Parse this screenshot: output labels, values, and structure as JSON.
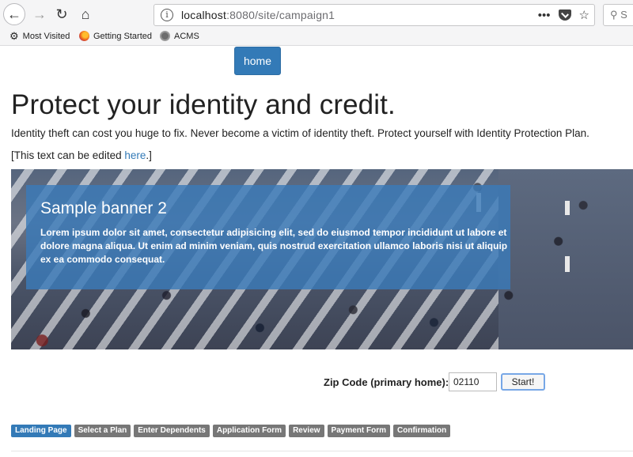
{
  "browser": {
    "url_host": "localhost",
    "url_rest": ":8080/site/campaign1",
    "search_placeholder": "S",
    "bookmarks": [
      {
        "label": "Most Visited",
        "icon": "gear-icon"
      },
      {
        "label": "Getting Started",
        "icon": "firefox-icon"
      },
      {
        "label": "ACMS",
        "icon": "globe-icon"
      }
    ]
  },
  "page": {
    "home_label": "home",
    "headline": "Protect your identity and credit.",
    "intro": "Identity theft can cost you huge to fix. Never become a victim of identity theft. Protect yourself with Identity Protection Plan.",
    "edit_prefix": "[This text can be edited ",
    "edit_link": "here",
    "edit_suffix": ".]"
  },
  "banner": {
    "title": "Sample banner 2",
    "text": "Lorem ipsum dolor sit amet, consectetur adipisicing elit, sed do eiusmod tempor incididunt ut labore et dolore magna aliqua. Ut enim ad minim veniam, quis nostrud exercitation ullamco laboris nisi ut aliquip ex ea commodo consequat.",
    "box_color": "#3a7ab8"
  },
  "zip": {
    "label": "Zip Code (primary home):",
    "value": "02110",
    "button": "Start!"
  },
  "steps": [
    {
      "label": "Landing Page",
      "active": true
    },
    {
      "label": "Select a Plan",
      "active": false
    },
    {
      "label": "Enter Dependents",
      "active": false
    },
    {
      "label": "Application Form",
      "active": false
    },
    {
      "label": "Review",
      "active": false
    },
    {
      "label": "Payment Form",
      "active": false
    },
    {
      "label": "Confirmation",
      "active": false
    }
  ],
  "colors": {
    "primary": "#337ab7",
    "step_inactive": "#777777"
  }
}
